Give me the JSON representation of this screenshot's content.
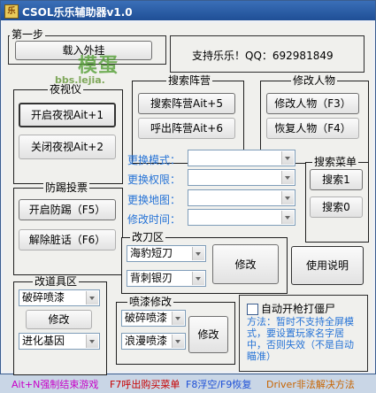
{
  "window": {
    "icon": "app-logo-icon",
    "title": "CSOL乐乐辅助器v1.0"
  },
  "watermark": {
    "site_name": "模蛋",
    "url": "bbs.lejia."
  },
  "step_one": {
    "label": "第一步",
    "button": "载入外挂"
  },
  "support_text": "支持乐乐！QQ：692981849",
  "night_vision": {
    "label": "夜视仪",
    "on": "开启夜视Ait+1",
    "off": "关闭夜视Ait+2"
  },
  "search_camp": {
    "label": "搜索阵营",
    "search": "搜索阵营Ait+5",
    "call": "呼出阵营Ait+6"
  },
  "modify_character": {
    "label": "修改人物",
    "modify": "修改人物（F3）",
    "restore": "恢复人物（F4）"
  },
  "change_fields": [
    {
      "label": "更换模式：",
      "value": ""
    },
    {
      "label": "更换权限：",
      "value": ""
    },
    {
      "label": "更换地图：",
      "value": ""
    },
    {
      "label": "修改时间：",
      "value": ""
    }
  ],
  "search_menu": {
    "label": "搜索菜单",
    "search1": "搜索1",
    "search0": "搜索0"
  },
  "anti_kick": {
    "label": "防踢投票",
    "on": "开启防踢（F5）",
    "off": "解除脏话（F6）"
  },
  "knife_area": {
    "label": "改刀区",
    "combo1": "海豹短刀",
    "combo2": "背刺银刃",
    "modify": "修改"
  },
  "help_button": "使用说明",
  "prop_area": {
    "label": "改道具区",
    "combo1": "破碎喷漆",
    "modify": "修改",
    "combo2": "进化基因"
  },
  "spray_modify": {
    "label": "喷漆修改",
    "combo1": "破碎喷漆",
    "combo2": "浪漫喷漆",
    "modify": "修改"
  },
  "auto_fire": {
    "label": "自动开枪打僵尸",
    "checked": false,
    "method": "方法：暂时不支持全屏模式，要设置玩家名字居中，否则失效（不是自动瞄准）"
  },
  "footer": {
    "hint1": "Ait+N强制结束游戏",
    "hint2": "F7呼出购买菜单",
    "hint3": "F8浮空/F9恢复",
    "hint4": "Driver非法解决方法"
  },
  "colors": {
    "title_bar": "#2a5fa8",
    "blue_label": "#2673d6",
    "footer_magenta": "#c800c8",
    "footer_red": "#c80000",
    "footer_blue": "#1c4fd6",
    "footer_orange": "#c86400"
  }
}
